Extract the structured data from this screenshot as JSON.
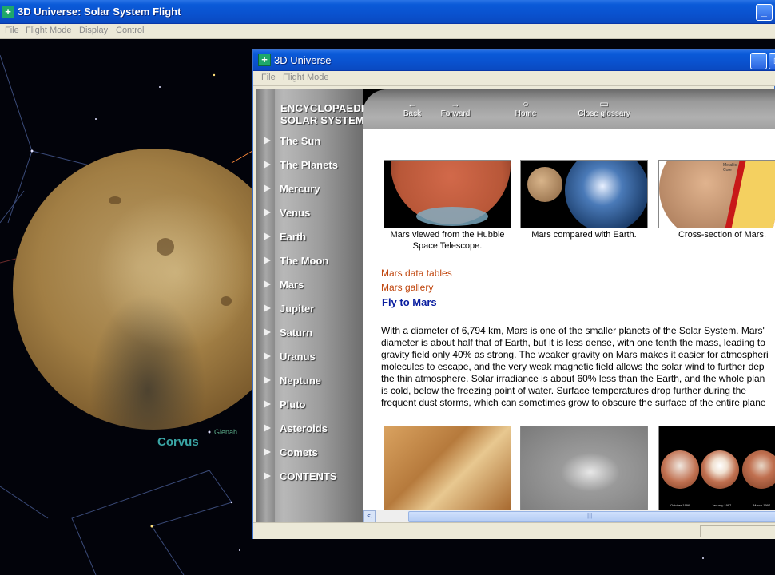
{
  "main_window": {
    "title": "3D Universe: Solar System Flight",
    "menu": [
      "File",
      "Flight Mode",
      "Display",
      "Control"
    ],
    "minimize_label": "_"
  },
  "space": {
    "constellation_label": "Corvus",
    "star_label": "Gienah"
  },
  "ency_window": {
    "title": "3D Universe",
    "menu": [
      "File",
      "Flight Mode"
    ],
    "minimize_label": "_",
    "maximize_label": "□"
  },
  "sidebar": {
    "brand_line1": "ENCYCLOPAEDIA",
    "brand_line2": "SOLAR SYSTEM",
    "items": [
      "The Sun",
      "The Planets",
      "Mercury",
      "Venus",
      "Earth",
      "The Moon",
      "Mars",
      "Jupiter",
      "Saturn",
      "Uranus",
      "Neptune",
      "Pluto",
      "Asteroids",
      "Comets",
      "CONTENTS"
    ]
  },
  "toolbar": {
    "back": "Back",
    "forward": "Forward",
    "home": "Home",
    "close_glossary": "Close glossary"
  },
  "content": {
    "images_top": [
      {
        "caption_line1": "Mars viewed from the Hubble",
        "caption_line2": "Space Telescope."
      },
      {
        "caption_line1": "Mars compared with Earth.",
        "caption_line2": ""
      },
      {
        "caption_line1": "Cross-section of Mars.",
        "caption_line2": ""
      }
    ],
    "cross_section_labels": [
      "Metallic",
      "Core"
    ],
    "links": {
      "data_tables": "Mars data tables",
      "gallery": "Mars gallery",
      "fly": "Fly to Mars"
    },
    "body_lines": [
      "With a diameter of 6,794 km, Mars is one of the smaller planets of the Solar System. Mars'",
      "diameter is about half that of Earth, but it is less dense, with one tenth the mass, leading to",
      "gravity field only 40% as strong. The weaker gravity on Mars makes it easier for atmospheri",
      "molecules to escape, and the very weak magnetic field allows the solar wind to further dep",
      "the thin atmosphere. Solar irradiance is about 60% less than the Earth, and the whole plan",
      "is cold, below the freezing point of water. Surface temperatures drop further during the",
      "frequent dust storms, which can sometimes grow to obscure the surface of the entire plane"
    ],
    "bottom_image_labels": [
      "October 1996",
      "January 1997",
      "March 1997"
    ]
  },
  "scrollbar": {
    "left_arrow": "<",
    "grip": "|||"
  }
}
